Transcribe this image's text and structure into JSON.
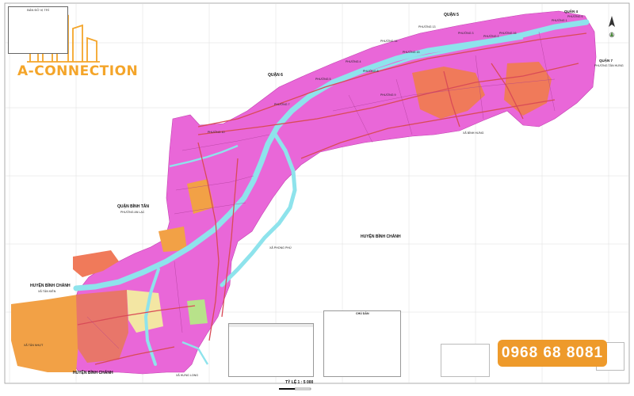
{
  "map": {
    "inset_title": "BẢN ĐỒ VỊ TRÍ",
    "scale": "TỶ LỆ 1 : 5 000",
    "districts": {
      "q5": "QUẬN 5",
      "q4": "QUẬN 4",
      "q7": "QUẬN 7",
      "q6": "QUẬN 6",
      "binh_tan": "QUẬN BÌNH TÂN",
      "binh_chanh_center": "HUYỆN BÌNH CHÁNH",
      "binh_chanh_left": "HUYỆN BÌNH CHÁNH",
      "binh_chanh_bottom": "HUYỆN BÌNH CHÁNH"
    },
    "subdistricts": {
      "tan_hung": "PHƯỜNG TÂN HƯNG",
      "an_lac": "PHƯỜNG AN LẠC",
      "tan_kien": "XÃ TÂN KIÊN",
      "binh_hung": "XÃ BÌNH HƯNG",
      "phong_phu": "XÃ PHONG PHÚ",
      "hung_long": "XÃ HƯNG LONG",
      "tan_nhut": "XÃ TÂN NHỰT"
    },
    "wards": {
      "w1": "PHƯỜNG 1",
      "w2": "PHƯỜNG 2",
      "w3": "PHƯỜNG 3",
      "w4": "PHƯỜNG 4",
      "w5": "PHƯỜNG 5",
      "w6": "PHƯỜNG 6",
      "w7": "PHƯỜNG 7",
      "w8": "PHƯỜNG 8",
      "w9": "PHƯỜNG 9",
      "w10": "PHƯỜNG 10",
      "w13": "PHƯỜNG 13",
      "w14": "PHƯỜNG 14",
      "w15": "PHƯỜNG 15",
      "w16": "PHƯỜNG 16"
    },
    "legend_title": "CHÚ DẪN"
  },
  "brand": {
    "name": "A-CONNECTION",
    "phone": "0968 68 8081"
  },
  "colors": {
    "residential": "#E967D8",
    "river": "#8EE3EC",
    "road": "#D94B57",
    "commercial": "#F07A5A",
    "industrial": "#F2A146",
    "green": "#B8E28A",
    "brand_orange": "#F4A52A",
    "badge_orange": "#EE9A2B"
  },
  "icons": {
    "compass": "north-arrow-icon",
    "logo": "building-skyline-icon"
  }
}
